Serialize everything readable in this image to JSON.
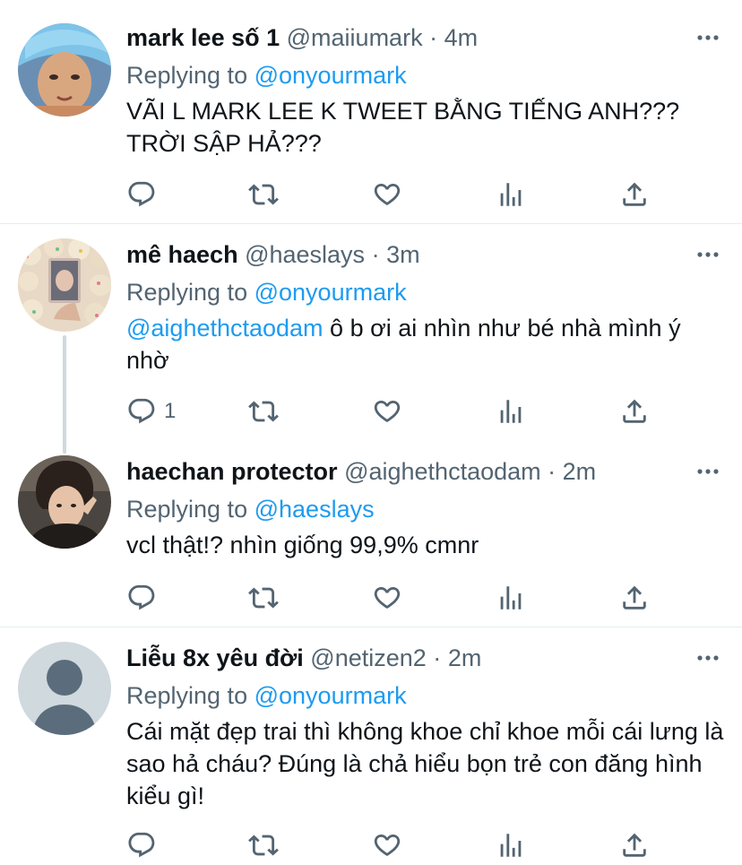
{
  "colors": {
    "accent": "#1d9bf0",
    "text": "#0f1419",
    "secondary": "#536471",
    "divider": "#e6ecf0"
  },
  "icons": [
    "more-icon",
    "reply-icon",
    "retweet-icon",
    "like-icon",
    "stats-icon",
    "share-icon"
  ],
  "replying_prefix": "Replying to",
  "tweets": [
    {
      "name": "mark lee số 1",
      "handle": "@maiiumark",
      "dot": "·",
      "time": "4m",
      "replying_to": "@onyourmark",
      "text": "VÃI L MARK LEE K TWEET BẰNG TIẾNG ANH??? TRỜI SẬP HẢ???",
      "reply_count": ""
    },
    {
      "name": "mê haech",
      "handle": "@haeslays",
      "dot": "·",
      "time": "3m",
      "replying_to": "@onyourmark",
      "mention": "@aighethctaodam",
      "text": " ô b ơi ai nhìn như bé nhà mình ý nhờ",
      "reply_count": "1"
    },
    {
      "name": "haechan protector",
      "handle": "@aighethctaodam",
      "dot": "·",
      "time": "2m",
      "replying_to": "@haeslays",
      "text": "vcl thật!? nhìn giống 99,9% cmnr",
      "reply_count": ""
    },
    {
      "name": "Liễu 8x yêu đời",
      "handle": "@netizen2",
      "dot": "·",
      "time": "2m",
      "replying_to": "@onyourmark",
      "text": "Cái mặt đẹp trai thì không khoe chỉ khoe mỗi cái lưng là sao hả cháu? Đúng là chả hiểu bọn trẻ con đăng hình kiểu gì!",
      "reply_count": ""
    }
  ]
}
